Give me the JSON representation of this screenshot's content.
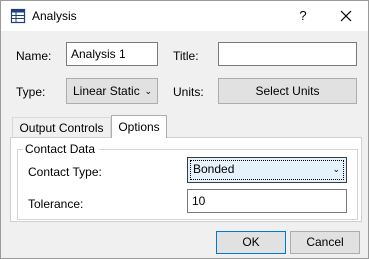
{
  "window": {
    "title": "Analysis",
    "help_label": "?"
  },
  "name": {
    "label": "Name:",
    "value": "Analysis 1"
  },
  "title_field": {
    "label": "Title:",
    "value": ""
  },
  "type": {
    "label": "Type:",
    "value": "Linear Static"
  },
  "units": {
    "label": "Units:",
    "button_label": "Select Units"
  },
  "tabs": [
    {
      "label": "Output Controls",
      "active": false
    },
    {
      "label": "Options",
      "active": true
    }
  ],
  "contact_data": {
    "legend": "Contact Data",
    "contact_type_label": "Contact Type:",
    "contact_type_value": "Bonded",
    "tolerance_label": "Tolerance:",
    "tolerance_value": "10"
  },
  "footer": {
    "ok_label": "OK",
    "cancel_label": "Cancel"
  },
  "icons": {
    "window": "table-icon",
    "close": "close-icon",
    "dropdown": "chevron-down-icon"
  }
}
